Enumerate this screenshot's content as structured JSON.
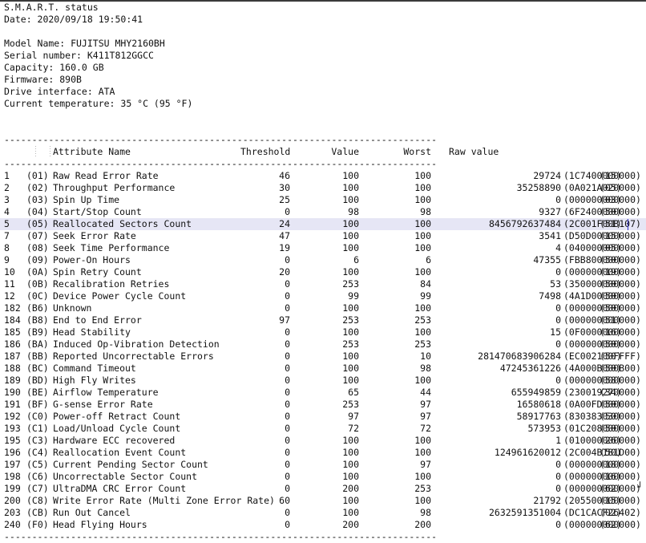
{
  "header": {
    "title": "S.M.A.R.T. status",
    "date_label": "Date: 2020/09/18 19:50:41",
    "model_name": "Model Name: FUJITSU MHY2160BH",
    "serial_number": "Serial number: K411T812GGCC",
    "capacity": "Capacity: 160.0 GB",
    "firmware": "Firmware: 890B",
    "drive_interface": "Drive interface: ATA",
    "current_temperature": "Current temperature: 35 °C (95 °F)"
  },
  "separator": "------------------------------------------------------------------------------",
  "columns": {
    "attribute_name": "Attribute Name",
    "threshold": "Threshold",
    "value": "Value",
    "worst": "Worst",
    "raw_value": "Raw value"
  },
  "selection": {
    "selected_row_index": 4,
    "highlight_color": "#e6e6f5",
    "caret_color": "#3232c8"
  },
  "bottom_mark": "┘",
  "rows": [
    {
      "num": "1",
      "hex": "(01)",
      "name": "Raw Read Error Rate",
      "threshold": "46",
      "value": "100",
      "worst": "100",
      "raw": "29724",
      "rawhex": "(1C7400000000)",
      "flag": "(15)"
    },
    {
      "num": "2",
      "hex": "(02)",
      "name": "Throughput Performance",
      "threshold": "30",
      "value": "100",
      "worst": "100",
      "raw": "35258890",
      "rawhex": "(0A021A020000)",
      "flag": "(05)"
    },
    {
      "num": "3",
      "hex": "(03)",
      "name": "Spin Up Time",
      "threshold": "25",
      "value": "100",
      "worst": "100",
      "raw": "0",
      "rawhex": "(000000000000)",
      "flag": "(03)"
    },
    {
      "num": "4",
      "hex": "(04)",
      "name": "Start/Stop Count",
      "threshold": "0",
      "value": "98",
      "worst": "98",
      "raw": "9327",
      "rawhex": "(6F2400000000)",
      "flag": "(50)"
    },
    {
      "num": "5",
      "hex": "(05)",
      "name": "Reallocated Sectors Count",
      "threshold": "24",
      "value": "100",
      "worst": "100",
      "raw": "8456792637484",
      "rawhex": "(2C001F00B107)",
      "flag": "(51)"
    },
    {
      "num": "7",
      "hex": "(07)",
      "name": "Seek Error Rate",
      "threshold": "47",
      "value": "100",
      "worst": "100",
      "raw": "3541",
      "rawhex": "(D50D00000000)",
      "flag": "(15)"
    },
    {
      "num": "8",
      "hex": "(08)",
      "name": "Seek Time Performance",
      "threshold": "19",
      "value": "100",
      "worst": "100",
      "raw": "4",
      "rawhex": "(040000000000)",
      "flag": "(05)"
    },
    {
      "num": "9",
      "hex": "(09)",
      "name": "Power-On Hours",
      "threshold": "0",
      "value": "6",
      "worst": "6",
      "raw": "47355",
      "rawhex": "(FBB800000000)",
      "flag": "(50)"
    },
    {
      "num": "10",
      "hex": "(0A)",
      "name": "Spin Retry Count",
      "threshold": "20",
      "value": "100",
      "worst": "100",
      "raw": "0",
      "rawhex": "(000000000000)",
      "flag": "(19)"
    },
    {
      "num": "11",
      "hex": "(0B)",
      "name": "Recalibration Retries",
      "threshold": "0",
      "value": "253",
      "worst": "84",
      "raw": "53",
      "rawhex": "(350000000000)",
      "flag": "(50)"
    },
    {
      "num": "12",
      "hex": "(0C)",
      "name": "Device Power Cycle Count",
      "threshold": "0",
      "value": "99",
      "worst": "99",
      "raw": "7498",
      "rawhex": "(4A1D00000000)",
      "flag": "(50)"
    },
    {
      "num": "182",
      "hex": "(B6)",
      "name": "Unknown",
      "threshold": "0",
      "value": "100",
      "worst": "100",
      "raw": "0",
      "rawhex": "(000000000000)",
      "flag": "(50)"
    },
    {
      "num": "184",
      "hex": "(B8)",
      "name": "End to End Error",
      "threshold": "97",
      "value": "253",
      "worst": "253",
      "raw": "0",
      "rawhex": "(000000000000)",
      "flag": "(51)"
    },
    {
      "num": "185",
      "hex": "(B9)",
      "name": "Head Stability",
      "threshold": "0",
      "value": "100",
      "worst": "100",
      "raw": "15",
      "rawhex": "(0F0000000000)",
      "flag": "(16)"
    },
    {
      "num": "186",
      "hex": "(BA)",
      "name": "Induced Op-Vibration Detection",
      "threshold": "0",
      "value": "253",
      "worst": "253",
      "raw": "0",
      "rawhex": "(000000000000)",
      "flag": "(50)"
    },
    {
      "num": "187",
      "hex": "(BB)",
      "name": "Reported Uncorrectable Errors",
      "threshold": "0",
      "value": "100",
      "worst": "10",
      "raw": "281470683906284",
      "rawhex": "(EC002100FFFF)",
      "flag": "(50)"
    },
    {
      "num": "188",
      "hex": "(BC)",
      "name": "Command Timeout",
      "threshold": "0",
      "value": "100",
      "worst": "98",
      "raw": "47245361226",
      "rawhex": "(4A000B000B00)",
      "flag": "(50)"
    },
    {
      "num": "189",
      "hex": "(BD)",
      "name": "High Fly Writes",
      "threshold": "0",
      "value": "100",
      "worst": "100",
      "raw": "0",
      "rawhex": "(000000000000)",
      "flag": "(58)"
    },
    {
      "num": "190",
      "hex": "(BE)",
      "name": "Airflow Temperature",
      "threshold": "0",
      "value": "65",
      "worst": "44",
      "raw": "655949859",
      "rawhex": "(230019270000)",
      "flag": "(34)"
    },
    {
      "num": "191",
      "hex": "(BF)",
      "name": "G-sense Error Rate",
      "threshold": "0",
      "value": "253",
      "worst": "97",
      "raw": "16580618",
      "rawhex": "(0A00FD000000)",
      "flag": "(50)"
    },
    {
      "num": "192",
      "hex": "(C0)",
      "name": "Power-off Retract Count",
      "threshold": "0",
      "value": "97",
      "worst": "97",
      "raw": "58917763",
      "rawhex": "(830383030000)",
      "flag": "(50)"
    },
    {
      "num": "193",
      "hex": "(C1)",
      "name": "Load/Unload Cycle Count",
      "threshold": "0",
      "value": "72",
      "worst": "72",
      "raw": "573953",
      "rawhex": "(01C208000000)",
      "flag": "(50)"
    },
    {
      "num": "195",
      "hex": "(C3)",
      "name": "Hardware ECC recovered",
      "threshold": "0",
      "value": "100",
      "worst": "100",
      "raw": "1",
      "rawhex": "(010000000000)",
      "flag": "(26)"
    },
    {
      "num": "196",
      "hex": "(C4)",
      "name": "Reallocation Event Count",
      "threshold": "0",
      "value": "100",
      "worst": "100",
      "raw": "124961620012",
      "rawhex": "(2C004B181D00)",
      "flag": "(50)"
    },
    {
      "num": "197",
      "hex": "(C5)",
      "name": "Current Pending Sector Count",
      "threshold": "0",
      "value": "100",
      "worst": "97",
      "raw": "0",
      "rawhex": "(000000000000)",
      "flag": "(18)"
    },
    {
      "num": "198",
      "hex": "(C6)",
      "name": "Uncorrectable Sector Count",
      "threshold": "0",
      "value": "100",
      "worst": "100",
      "raw": "0",
      "rawhex": "(000000000000)",
      "flag": "(16)"
    },
    {
      "num": "199",
      "hex": "(C7)",
      "name": "UltraDMA CRC Error Count",
      "threshold": "0",
      "value": "200",
      "worst": "253",
      "raw": "0",
      "rawhex": "(000000000000)",
      "flag": "(62)"
    },
    {
      "num": "200",
      "hex": "(C8)",
      "name": "Write Error Rate (Multi Zone Error Rate)",
      "threshold": "60",
      "value": "100",
      "worst": "100",
      "raw": "21792",
      "rawhex": "(205500000000)",
      "flag": "(15)"
    },
    {
      "num": "203",
      "hex": "(CB)",
      "name": "Run Out Cancel",
      "threshold": "0",
      "value": "100",
      "worst": "98",
      "raw": "2632591351004",
      "rawhex": "(DC1CACF26402)",
      "flag": "(02)"
    },
    {
      "num": "240",
      "hex": "(F0)",
      "name": "Head Flying Hours",
      "threshold": "0",
      "value": "200",
      "worst": "200",
      "raw": "0",
      "rawhex": "(000000000000)",
      "flag": "(62)"
    }
  ]
}
